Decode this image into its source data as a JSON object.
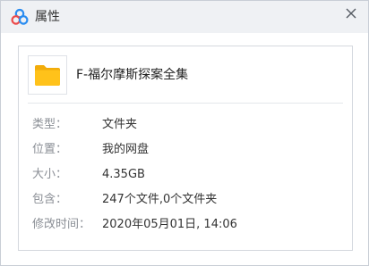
{
  "window": {
    "title": "属性",
    "logo_icon": "baidu-netdisk-cloud-icon",
    "close_icon": "close-icon"
  },
  "file": {
    "icon": "folder-icon",
    "icon_color": "#FFC21A",
    "name": "F-福尔摩斯探案全集"
  },
  "properties": [
    {
      "label": "类型：",
      "value": "文件夹"
    },
    {
      "label": "位置：",
      "value": "我的网盘"
    },
    {
      "label": "大小：",
      "value": "4.35GB"
    },
    {
      "label": "包含：",
      "value": "247个文件,0个文件夹"
    },
    {
      "label": "修改时间：",
      "value": "2020年05月01日, 14:06"
    }
  ],
  "colors": {
    "titlebar_bg": "#EFF1F4",
    "logo_blue": "#2A8CF0",
    "logo_red": "#EC4B4B",
    "label_gray": "#8B8F96"
  }
}
